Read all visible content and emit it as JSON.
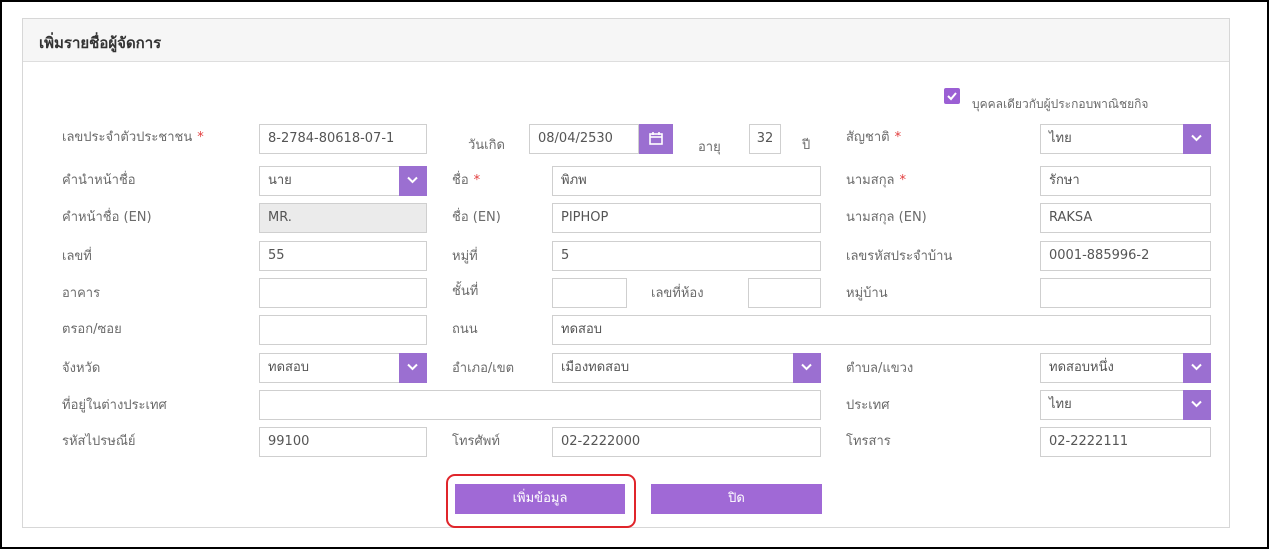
{
  "panel": {
    "title": "เพิ่มรายชื่อผู้จัดการ"
  },
  "checkbox": {
    "label": "บุคคลเดียวกับผู้ประกอบพาณิชยกิจ",
    "checked": true
  },
  "row1": {
    "id_label": "เลขประจำตัวประชาชน",
    "id_value": "8-2784-80618-07-1",
    "birth_label": "วันเกิด",
    "birth_value": "08/04/2530",
    "age_label": "อายุ",
    "age_value": "32",
    "age_unit": "ปี",
    "nationality_label": "สัญชาติ",
    "nationality_value": "ไทย"
  },
  "row2": {
    "prefix_label": "คำนำหน้าชื่อ",
    "prefix_value": "นาย",
    "firstname_label": "ชื่อ",
    "firstname_value": "พิภพ",
    "lastname_label": "นามสกุล",
    "lastname_value": "รักษา"
  },
  "row3": {
    "prefix_en_label": "คำหน้าชื่อ (EN)",
    "prefix_en_value": "MR.",
    "firstname_en_label": "ชื่อ (EN)",
    "firstname_en_value": "PIPHOP",
    "lastname_en_label": "นามสกุล (EN)",
    "lastname_en_value": "RAKSA"
  },
  "row4": {
    "house_no_label": "เลขที่",
    "house_no_value": "55",
    "moo_label": "หมู่ที่",
    "moo_value": "5",
    "house_code_label": "เลขรหัสประจำบ้าน",
    "house_code_value": "0001-885996-2"
  },
  "row5": {
    "building_label": "อาคาร",
    "building_value": "",
    "floor_label": "ชั้นที่",
    "floor_value": "",
    "room_label": "เลขที่ห้อง",
    "room_value": "",
    "village_label": "หมู่บ้าน",
    "village_value": ""
  },
  "row6": {
    "soi_label": "ตรอก/ซอย",
    "soi_value": "",
    "road_label": "ถนน",
    "road_value": "ทดสอบ"
  },
  "row7": {
    "province_label": "จังหวัด",
    "province_value": "ทดสอบ",
    "district_label": "อำเภอ/เขต",
    "district_value": "เมืองทดสอบ",
    "subdistrict_label": "ตำบล/แขวง",
    "subdistrict_value": "ทดสอบหนึ่ง"
  },
  "row8": {
    "foreign_addr_label": "ที่อยู่ในต่างประเทศ",
    "foreign_addr_value": "",
    "country_label": "ประเทศ",
    "country_value": "ไทย"
  },
  "row9": {
    "postcode_label": "รหัสไปรษณีย์",
    "postcode_value": "99100",
    "phone_label": "โทรศัพท์",
    "phone_value": "02-2222000",
    "fax_label": "โทรสาร",
    "fax_value": "02-2222111"
  },
  "buttons": {
    "add": "เพิ่มข้อมูล",
    "close": "ปิด"
  },
  "required_mark": "*",
  "colors": {
    "accent": "#a069d6",
    "highlight": "#e0252b",
    "required": "#e23b3b"
  },
  "icons": {
    "dropdown": "chevron-down-icon",
    "calendar": "calendar-icon",
    "checkbox": "check-icon"
  }
}
